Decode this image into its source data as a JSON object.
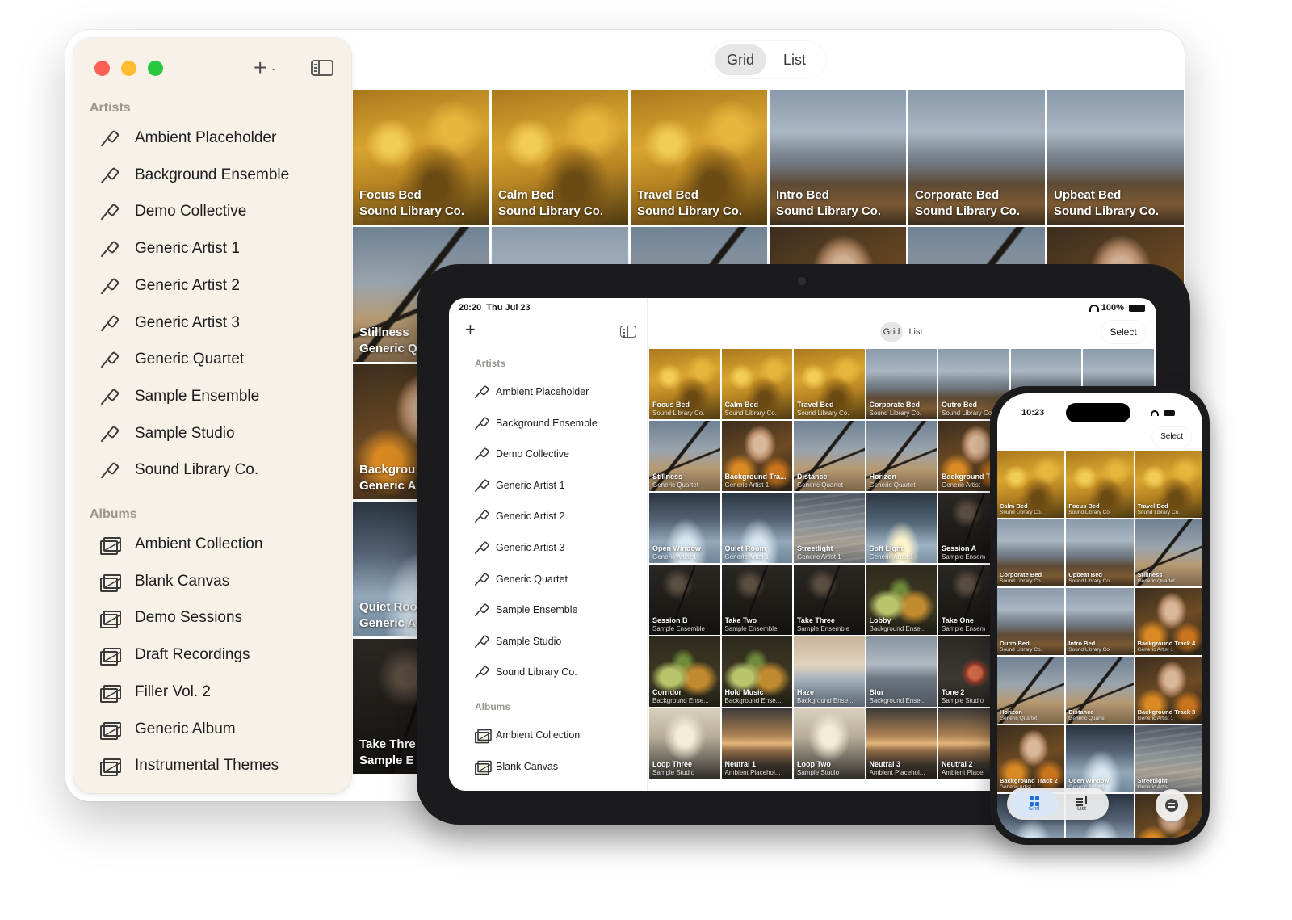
{
  "mac": {
    "view_toggle": {
      "grid": "Grid",
      "list": "List"
    },
    "sidebar": {
      "artists_header": "Artists",
      "albums_header": "Albums",
      "artists": [
        "Ambient Placeholder",
        "Background Ensemble",
        "Demo Collective",
        "Generic Artist 1",
        "Generic Artist 2",
        "Generic Artist 3",
        "Generic Quartet",
        "Sample Ensemble",
        "Sample Studio",
        "Sound Library Co."
      ],
      "albums": [
        "Ambient Collection",
        "Blank Canvas",
        "Demo Sessions",
        "Draft Recordings",
        "Filler Vol. 2",
        "Generic Album",
        "Instrumental Themes"
      ]
    },
    "grid": [
      {
        "title": "Focus Bed",
        "artist": "Sound Library Co.",
        "art": "bloom"
      },
      {
        "title": "Calm Bed",
        "artist": "Sound Library Co.",
        "art": "bloom"
      },
      {
        "title": "Travel Bed",
        "artist": "Sound Library Co.",
        "art": "bloom"
      },
      {
        "title": "Intro Bed",
        "artist": "Sound Library Co.",
        "art": "lake"
      },
      {
        "title": "Corporate Bed",
        "artist": "Sound Library Co.",
        "art": "lake"
      },
      {
        "title": "Upbeat Bed",
        "artist": "Sound Library Co.",
        "art": "lake"
      },
      {
        "title": "Stillness",
        "artist": "Generic Q",
        "art": "branch"
      },
      {
        "title": "",
        "artist": "",
        "art": "lake"
      },
      {
        "title": "",
        "artist": "",
        "art": "branch"
      },
      {
        "title": "",
        "artist": "",
        "art": "leaf"
      },
      {
        "title": "",
        "artist": "",
        "art": "branch"
      },
      {
        "title": "",
        "artist": "",
        "art": "leaf"
      },
      {
        "title": "Backgrou",
        "artist": "Generic A",
        "art": "leaf"
      },
      {
        "title": "",
        "artist": "",
        "art": "frost"
      },
      {
        "title": "",
        "artist": "",
        "art": "street"
      },
      {
        "title": "",
        "artist": "",
        "art": "soft"
      },
      {
        "title": "",
        "artist": "",
        "art": "dark"
      },
      {
        "title": "",
        "artist": "",
        "art": "gourd"
      },
      {
        "title": "Quiet Roo",
        "artist": "Generic A",
        "art": "frost"
      },
      {
        "title": "",
        "artist": "",
        "art": "dark"
      },
      {
        "title": "",
        "artist": "",
        "art": "dark"
      },
      {
        "title": "",
        "artist": "",
        "art": "gourd"
      },
      {
        "title": "",
        "artist": "",
        "art": "haze"
      },
      {
        "title": "",
        "artist": "",
        "art": "tone"
      },
      {
        "title": "Take Thre",
        "artist": "Sample E",
        "art": "dark"
      },
      {
        "title": "",
        "artist": "",
        "art": "loop"
      },
      {
        "title": "",
        "artist": "",
        "art": "neutral"
      },
      {
        "title": "",
        "artist": "",
        "art": "loop"
      },
      {
        "title": "",
        "artist": "",
        "art": "neutral"
      },
      {
        "title": "",
        "artist": "",
        "art": "neutral"
      }
    ]
  },
  "ipad": {
    "status": {
      "time": "20:20",
      "date": "Thu Jul 23",
      "battery": "100%"
    },
    "view_toggle": {
      "grid": "Grid",
      "list": "List"
    },
    "select_label": "Select",
    "sidebar": {
      "artists_header": "Artists",
      "albums_header": "Albums",
      "artists": [
        "Ambient Placeholder",
        "Background Ensemble",
        "Demo Collective",
        "Generic Artist 1",
        "Generic Artist 2",
        "Generic Artist 3",
        "Generic Quartet",
        "Sample Ensemble",
        "Sample Studio",
        "Sound Library Co."
      ],
      "albums": [
        "Ambient Collection",
        "Blank Canvas"
      ]
    },
    "grid": [
      {
        "title": "Focus Bed",
        "artist": "Sound Library Co.",
        "art": "bloom"
      },
      {
        "title": "Calm Bed",
        "artist": "Sound Library Co.",
        "art": "bloom"
      },
      {
        "title": "Travel Bed",
        "artist": "Sound Library Co.",
        "art": "bloom"
      },
      {
        "title": "Corporate Bed",
        "artist": "Sound Library Co.",
        "art": "lake"
      },
      {
        "title": "Outro Bed",
        "artist": "Sound Library Co.",
        "art": "lake"
      },
      {
        "title": "",
        "artist": "",
        "art": "lake"
      },
      {
        "title": "",
        "artist": "",
        "art": "lake"
      },
      {
        "title": "Stillness",
        "artist": "Generic Quartet",
        "art": "branch"
      },
      {
        "title": "Background Tra...",
        "artist": "Generic Artist 1",
        "art": "leaf"
      },
      {
        "title": "Distance",
        "artist": "Generic Quartet",
        "art": "branch"
      },
      {
        "title": "Horizon",
        "artist": "Generic Quartet",
        "art": "branch"
      },
      {
        "title": "Background T",
        "artist": "Generic Artist",
        "art": "leaf"
      },
      {
        "title": "",
        "artist": "",
        "art": "leaf"
      },
      {
        "title": "",
        "artist": "",
        "art": "branch"
      },
      {
        "title": "Open Window",
        "artist": "Generic Artist 1",
        "art": "frost"
      },
      {
        "title": "Quiet Room",
        "artist": "Generic Artist 1",
        "art": "frost"
      },
      {
        "title": "Streetlight",
        "artist": "Generic Artist 1",
        "art": "street"
      },
      {
        "title": "Soft Light",
        "artist": "Generic Artist 1",
        "art": "soft"
      },
      {
        "title": "Session A",
        "artist": "Sample Ensem",
        "art": "dark"
      },
      {
        "title": "",
        "artist": "",
        "art": "dark"
      },
      {
        "title": "",
        "artist": "",
        "art": "frost"
      },
      {
        "title": "Session B",
        "artist": "Sample Ensemble",
        "art": "dark"
      },
      {
        "title": "Take Two",
        "artist": "Sample Ensemble",
        "art": "dark"
      },
      {
        "title": "Take Three",
        "artist": "Sample Ensemble",
        "art": "dark"
      },
      {
        "title": "Lobby",
        "artist": "Background Ense...",
        "art": "gourd"
      },
      {
        "title": "Take One",
        "artist": "Sample Ensem",
        "art": "dark"
      },
      {
        "title": "",
        "artist": "",
        "art": "gourd"
      },
      {
        "title": "",
        "artist": "",
        "art": "dark"
      },
      {
        "title": "Corridor",
        "artist": "Background Ense...",
        "art": "gourd"
      },
      {
        "title": "Hold Music",
        "artist": "Background Ense...",
        "art": "gourd"
      },
      {
        "title": "Haze",
        "artist": "Background Ense...",
        "art": "haze"
      },
      {
        "title": "Blur",
        "artist": "Background Ense...",
        "art": "blur"
      },
      {
        "title": "Tone 2",
        "artist": "Sample Studio",
        "art": "tone"
      },
      {
        "title": "",
        "artist": "",
        "art": "tone"
      },
      {
        "title": "",
        "artist": "",
        "art": "haze"
      },
      {
        "title": "Loop Three",
        "artist": "Sample Studio",
        "art": "loop"
      },
      {
        "title": "Neutral 1",
        "artist": "Ambient Placehol...",
        "art": "neutral"
      },
      {
        "title": "Loop Two",
        "artist": "Sample Studio",
        "art": "loop"
      },
      {
        "title": "Neutral 3",
        "artist": "Ambient Placehol...",
        "art": "neutral"
      },
      {
        "title": "Neutral 2",
        "artist": "Ambient Placel",
        "art": "neutral"
      },
      {
        "title": "",
        "artist": "",
        "art": "neutral"
      },
      {
        "title": "",
        "artist": "",
        "art": "loop"
      }
    ]
  },
  "iphone": {
    "status": {
      "time": "10:23"
    },
    "select_label": "Select",
    "tabs": {
      "grid": "Grid",
      "list": "List"
    },
    "grid": [
      {
        "title": "Calm Bed",
        "artist": "Sound Library Co.",
        "art": "bloom"
      },
      {
        "title": "Focus Bed",
        "artist": "Sound Library Co.",
        "art": "bloom"
      },
      {
        "title": "Travel Bed",
        "artist": "Sound Library Co.",
        "art": "bloom"
      },
      {
        "title": "Corporate Bed",
        "artist": "Sound Library Co.",
        "art": "lake"
      },
      {
        "title": "Upbeat Bed",
        "artist": "Sound Library Co.",
        "art": "lake"
      },
      {
        "title": "Stillness",
        "artist": "Generic Quartet",
        "art": "branch"
      },
      {
        "title": "Outro Bed",
        "artist": "Sound Library Co.",
        "art": "lake"
      },
      {
        "title": "Intro Bed",
        "artist": "Sound Library Co.",
        "art": "lake"
      },
      {
        "title": "Background Track 4",
        "artist": "Generic Artist 1",
        "art": "leaf"
      },
      {
        "title": "Horizon",
        "artist": "Generic Quartet",
        "art": "branch"
      },
      {
        "title": "Distance",
        "artist": "Generic Quartet",
        "art": "branch"
      },
      {
        "title": "Background Track 3",
        "artist": "Generic Artist 1",
        "art": "leaf"
      },
      {
        "title": "Background Track 2",
        "artist": "Generic Artist 1",
        "art": "leaf"
      },
      {
        "title": "Open Window",
        "artist": "Generic Artist 1",
        "art": "frost"
      },
      {
        "title": "Streetlight",
        "artist": "Generic Artist 1",
        "art": "street"
      },
      {
        "title": "",
        "artist": "",
        "art": "frost"
      },
      {
        "title": "",
        "artist": "",
        "art": "frost"
      },
      {
        "title": "",
        "artist": "",
        "art": "leaf"
      }
    ]
  }
}
